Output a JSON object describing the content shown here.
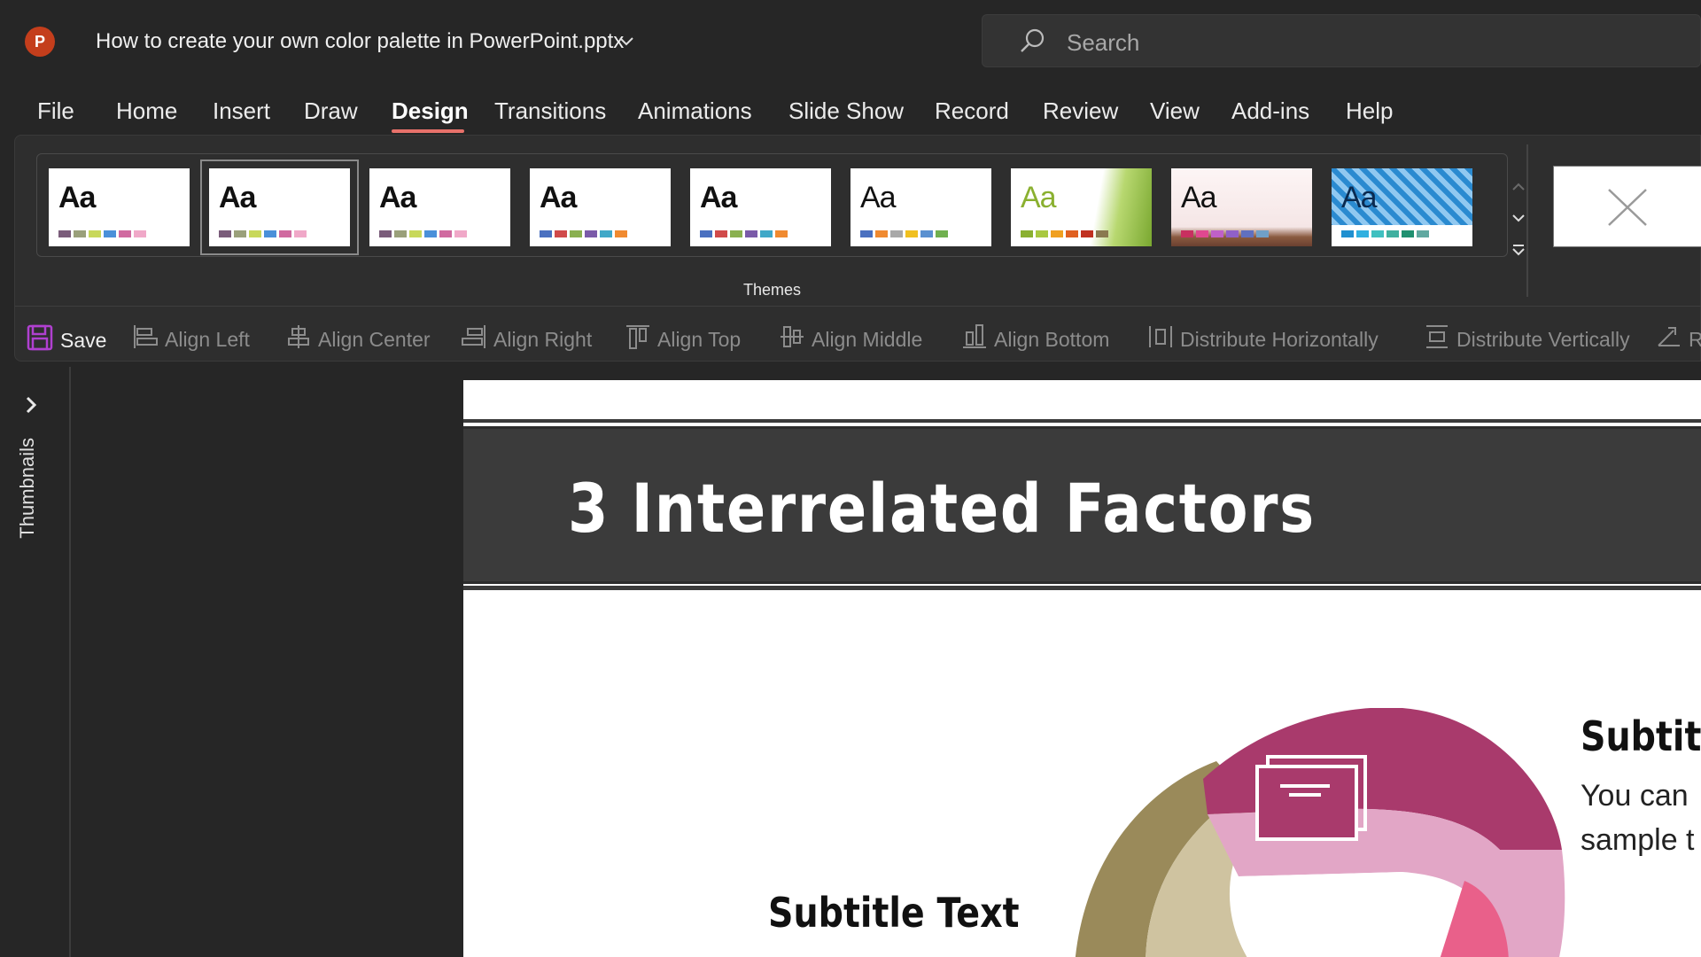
{
  "app": {
    "logo_letter": "P",
    "document_title": "How to create your own color palette in PowerPoint.pptx"
  },
  "search": {
    "placeholder": "Search"
  },
  "menu": {
    "tabs": [
      "File",
      "Home",
      "Insert",
      "Draw",
      "Design",
      "Transitions",
      "Animations",
      "Slide Show",
      "Record",
      "Review",
      "View",
      "Add-ins",
      "Help"
    ],
    "active": "Design"
  },
  "ribbon": {
    "group_label": "Themes",
    "themes": [
      {
        "label": "Aa",
        "colors": [
          "#7a5c7a",
          "#9aa07a",
          "#c8d85a",
          "#4a90d9",
          "#d06aa0",
          "#f0a8c8"
        ]
      },
      {
        "label": "Aa",
        "colors": [
          "#7a5c7a",
          "#9aa07a",
          "#c8d85a",
          "#4a90d9",
          "#d06aa0",
          "#f0a8c8"
        ]
      },
      {
        "label": "Aa",
        "colors": [
          "#7a5c7a",
          "#9aa07a",
          "#c8d85a",
          "#4a90d9",
          "#d06aa0",
          "#f0a8c8"
        ]
      },
      {
        "label": "Aa",
        "colors": [
          "#4a70c0",
          "#d04a4a",
          "#8ab050",
          "#7a5aa8",
          "#40a8c8",
          "#f08a30"
        ]
      },
      {
        "label": "Aa",
        "colors": [
          "#4a70c0",
          "#d04a4a",
          "#8ab050",
          "#7a5aa8",
          "#40a8c8",
          "#f08a30"
        ]
      },
      {
        "label": "Aa",
        "colors": [
          "#4a70c0",
          "#f08a30",
          "#a8a8a8",
          "#f0c020",
          "#5a90d0",
          "#70b050"
        ]
      },
      {
        "label": "Aa",
        "colors": [
          "#8ab030",
          "#a8c840",
          "#f0a020",
          "#e06020",
          "#c03020",
          "#8a7a50"
        ]
      },
      {
        "label": "Aa",
        "colors": [
          "#c83060",
          "#e04890",
          "#c060c8",
          "#9060c8",
          "#6070c0",
          "#70a0c8"
        ]
      },
      {
        "label": "Aa",
        "colors": [
          "#2090d0",
          "#30b0e0",
          "#40c0c0",
          "#40b0a0",
          "#209070",
          "#60a8a0"
        ]
      }
    ]
  },
  "quick_access": {
    "save": "Save",
    "align_left": "Align Left",
    "align_center": "Align Center",
    "align_right": "Align Right",
    "align_top": "Align Top",
    "align_middle": "Align Middle",
    "align_bottom": "Align Bottom",
    "distribute_h": "Distribute Horizontally",
    "distribute_v": "Distribute Vertically",
    "truncated": "R"
  },
  "left_panel": {
    "label": "Thumbnails"
  },
  "slide": {
    "title": "3 Interrelated Factors",
    "subtitle_left": "Subtitle Text",
    "subtitle_right": "Subtitl",
    "body_right_line1": "You can",
    "body_right_line2": "sample t"
  },
  "colors": {
    "accent": "#e8716a",
    "dark_bg": "#262626",
    "ribbon_bg": "#2e2e2e"
  }
}
